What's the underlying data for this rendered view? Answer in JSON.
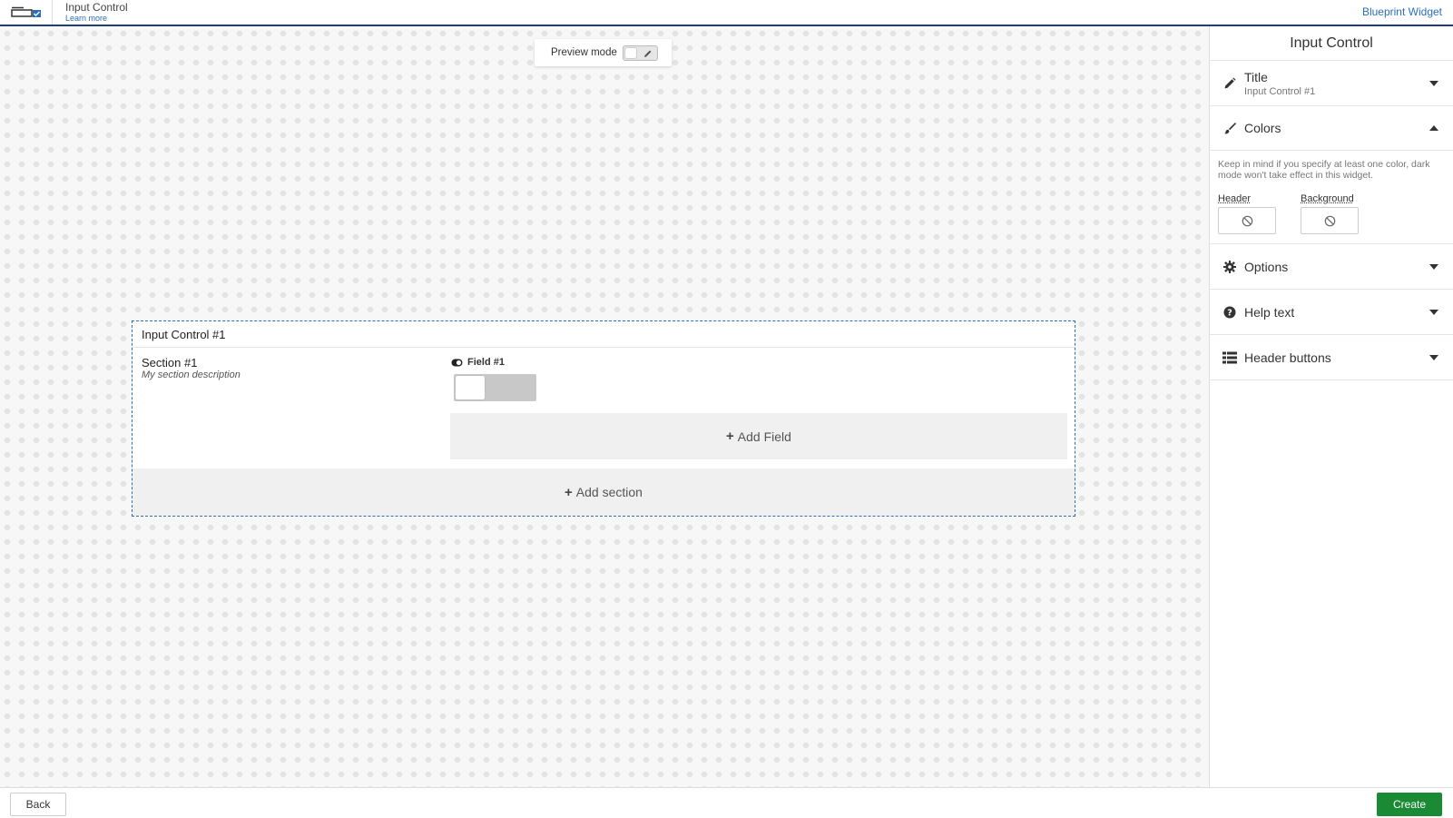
{
  "header": {
    "app_title": "Input Control",
    "learn_more": "Learn more",
    "blueprint_link": "Blueprint Widget",
    "logo_icon": "input-control-logo-icon"
  },
  "canvas": {
    "preview_mode_label": "Preview mode",
    "preview_mode_on": false
  },
  "widget": {
    "title": "Input Control #1",
    "section": {
      "title": "Section #1",
      "description": "My section description",
      "field_label": "Field #1",
      "field_value": false
    },
    "add_field": "Add Field",
    "add_section": "Add section"
  },
  "panel": {
    "title": "Input Control",
    "title_section": {
      "label": "Title",
      "value": "Input Control #1"
    },
    "colors": {
      "label": "Colors",
      "note": "Keep in mind if you specify at least one color, dark mode won't take effect in this widget.",
      "header_label": "Header",
      "background_label": "Background"
    },
    "options": "Options",
    "help_text": "Help text",
    "header_buttons": "Header buttons"
  },
  "footer": {
    "back": "Back",
    "create": "Create"
  },
  "colors": {
    "accent": "#2a6ebb",
    "topbar_border": "#1f3d7a",
    "create": "#1b8a34"
  }
}
